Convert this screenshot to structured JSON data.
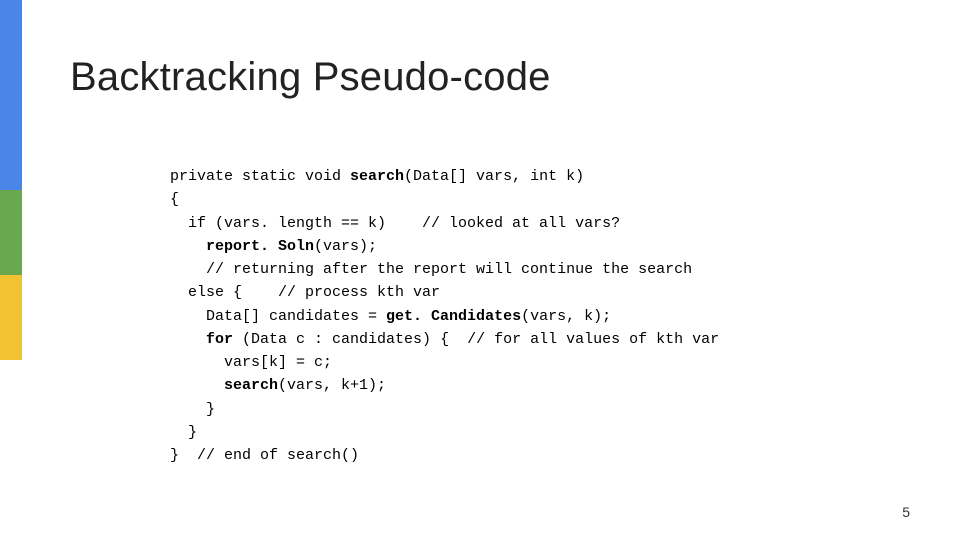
{
  "title": "Backtracking Pseudo-code",
  "code": {
    "l1a": "private static void ",
    "l1b": "search",
    "l1c": "(Data[] vars, int k)",
    "l2": "{",
    "l3": "  if (vars. length == k)    // looked at all vars?",
    "l4a": "    ",
    "l4b": "report. Soln",
    "l4c": "(vars);",
    "l5": "    // returning after the report will continue the search",
    "l6": "  else {    // process kth var",
    "l7a": "    Data[] candidates = ",
    "l7b": "get. Candidates",
    "l7c": "(vars, k);",
    "l8a": "    ",
    "l8b": "for",
    "l8c": " (Data c : candidates) {  // for all values of kth var",
    "l9": "      vars[k] = c;",
    "l10a": "      ",
    "l10b": "search",
    "l10c": "(vars, k+1);",
    "l11": "    }",
    "l12": "  }",
    "l13": "}  // end of search()"
  },
  "page": "5"
}
